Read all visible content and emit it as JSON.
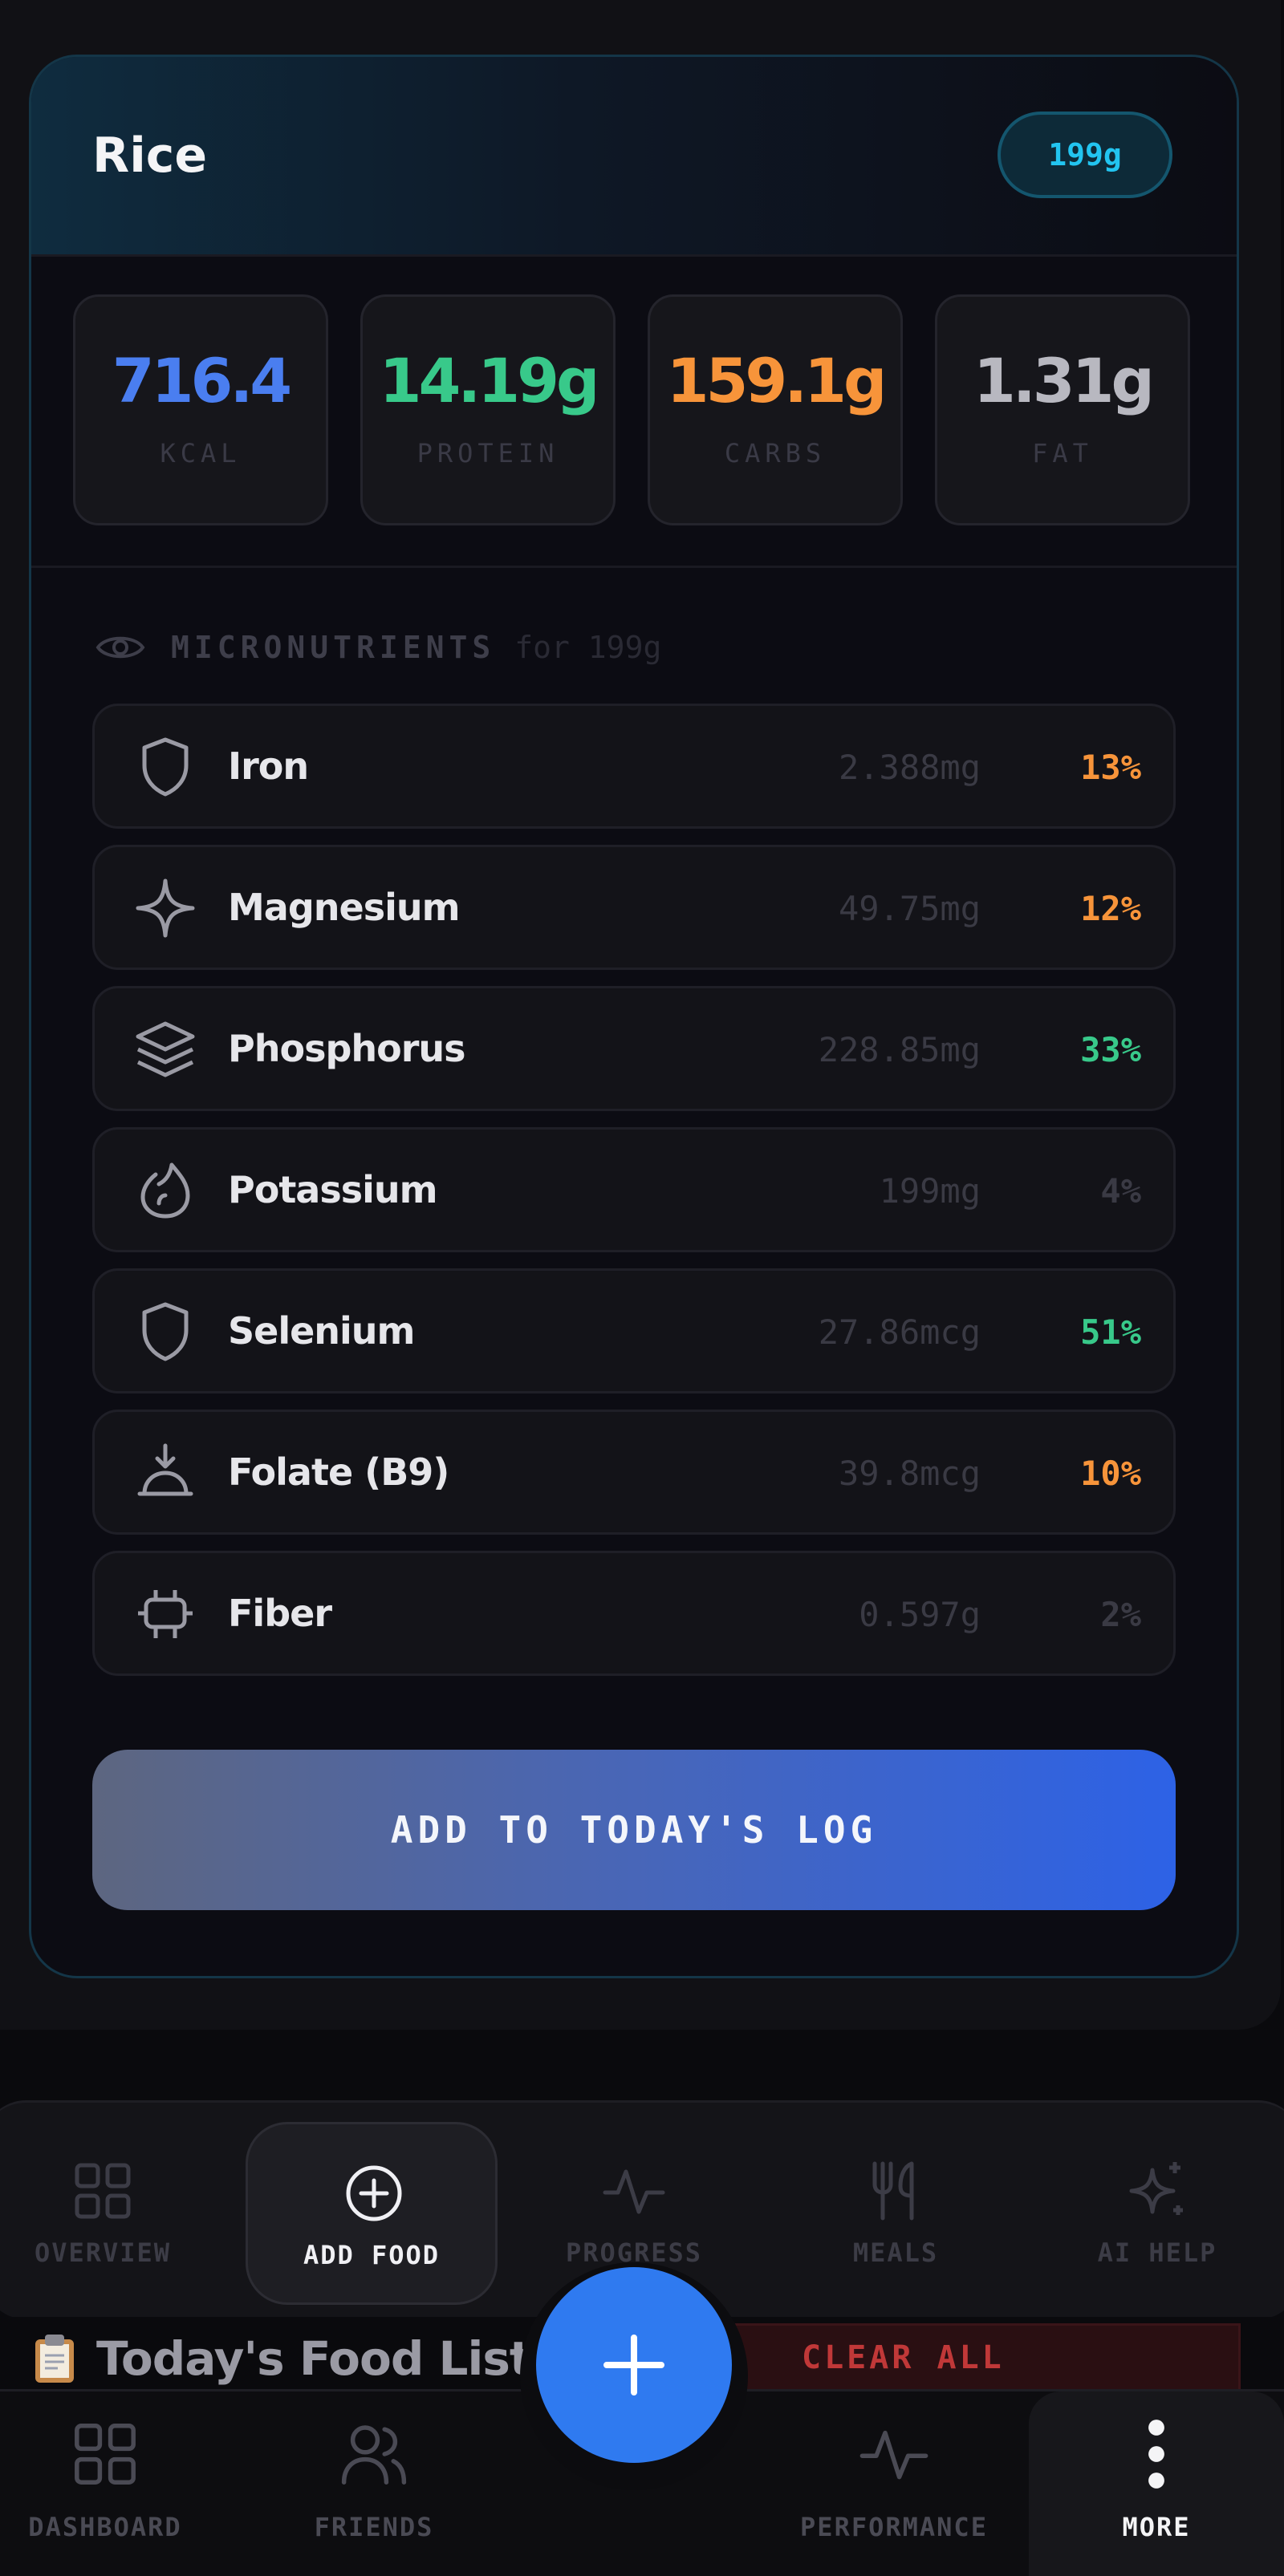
{
  "food": {
    "name": "Rice",
    "weight": "199g",
    "macros": {
      "kcal": {
        "value": "716.4",
        "label": "KCAL",
        "color": "#4a7ef0"
      },
      "protein": {
        "value": "14.19g",
        "label": "PROTEIN",
        "color": "#38c98a"
      },
      "carbs": {
        "value": "159.1g",
        "label": "CARBS",
        "color": "#f7943a"
      },
      "fat": {
        "value": "1.31g",
        "label": "FAT",
        "color": "#b8b8c0"
      }
    },
    "micronutrients": {
      "title": "MICRONUTRIENTS",
      "subtitle": "for 199g",
      "items": [
        {
          "name": "Iron",
          "amount": "2.388mg",
          "percent": "13%",
          "icon": "shield-icon",
          "color": "#f7943a"
        },
        {
          "name": "Magnesium",
          "amount": "49.75mg",
          "percent": "12%",
          "icon": "sparkle-icon",
          "color": "#f7943a"
        },
        {
          "name": "Phosphorus",
          "amount": "228.85mg",
          "percent": "33%",
          "icon": "layers-icon",
          "color": "#38c98a"
        },
        {
          "name": "Potassium",
          "amount": "199mg",
          "percent": "4%",
          "icon": "flame-icon",
          "color": "#3a3a44"
        },
        {
          "name": "Selenium",
          "amount": "27.86mcg",
          "percent": "51%",
          "icon": "shield-icon",
          "color": "#38c98a"
        },
        {
          "name": "Folate (B9)",
          "amount": "39.8mcg",
          "percent": "10%",
          "icon": "bowl-icon",
          "color": "#f7943a"
        },
        {
          "name": "Fiber",
          "amount": "0.597g",
          "percent": "2%",
          "icon": "plug-icon",
          "color": "#3a3a44"
        }
      ]
    },
    "add_button": "ADD TO TODAY'S LOG"
  },
  "nav_top": [
    {
      "label": "OVERVIEW",
      "icon": "grid-icon"
    },
    {
      "label": "ADD FOOD",
      "icon": "plus-circle-icon",
      "active": true
    },
    {
      "label": "PROGRESS",
      "icon": "activity-icon"
    },
    {
      "label": "MEALS",
      "icon": "utensils-icon"
    },
    {
      "label": "AI HELP",
      "icon": "sparkles-icon"
    }
  ],
  "food_list": {
    "icon": "clipboard-icon",
    "title": "Today's Food List",
    "clear_label": "CLEAR ALL"
  },
  "nav_bottom": [
    {
      "label": "DASHBOARD",
      "icon": "grid-icon"
    },
    {
      "label": "FRIENDS",
      "icon": "users-icon"
    },
    {
      "label": "PERFORMANCE",
      "icon": "activity-icon"
    },
    {
      "label": "MORE",
      "icon": "more-vertical-icon",
      "active": true
    }
  ],
  "fab": {
    "icon": "plus-icon",
    "color": "#2f7af0"
  }
}
